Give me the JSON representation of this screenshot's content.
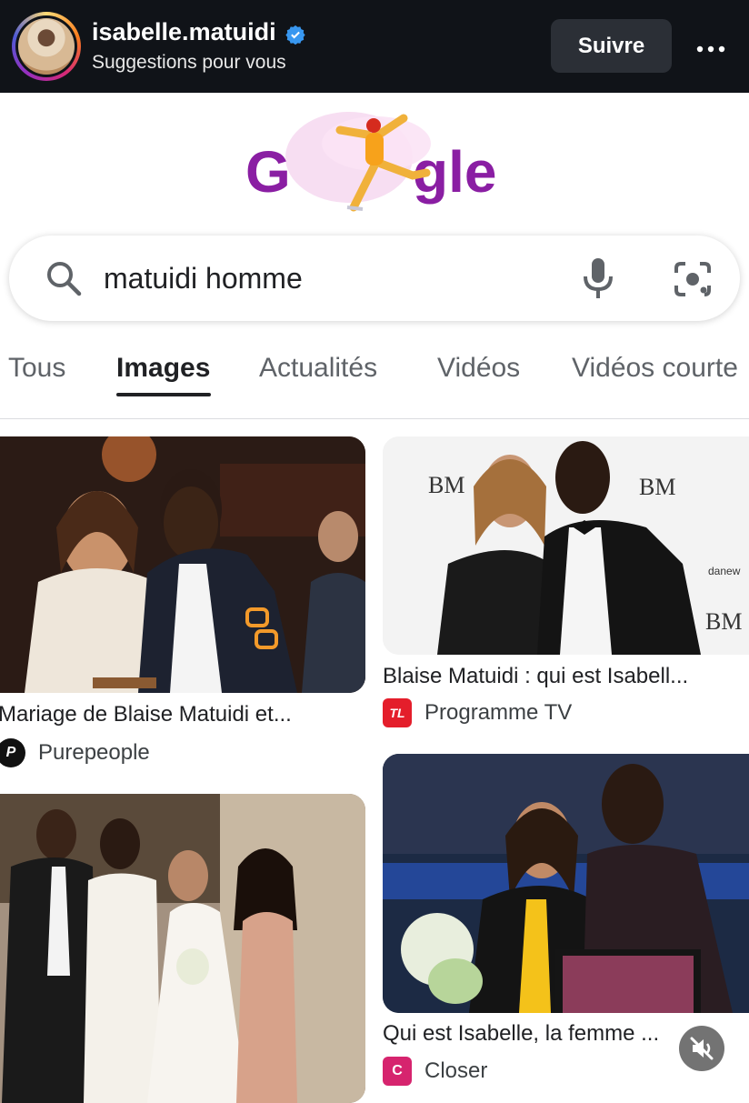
{
  "instagram": {
    "username": "isabelle.matuidi",
    "subtitle": "Suggestions pour vous",
    "follow_label": "Suivre"
  },
  "search": {
    "query": "matuidi homme"
  },
  "tabs": [
    {
      "label": "Tous"
    },
    {
      "label": "Images"
    },
    {
      "label": "Actualités"
    },
    {
      "label": "Vidéos"
    },
    {
      "label": "Vidéos courte"
    }
  ],
  "results": [
    {
      "title": "Mariage de Blaise Matuidi et...",
      "source": "Purepeople",
      "source_icon_text": "P"
    },
    {
      "title": "Blaise Matuidi : qui est Isabell...",
      "source": "Programme TV",
      "source_icon_text": "TL"
    },
    {
      "title": "",
      "source": "",
      "source_icon_text": ""
    },
    {
      "title": "Qui est Isabelle, la femme ...",
      "source": "Closer",
      "source_icon_text": "C"
    }
  ],
  "colors": {
    "header_bg": "#101318",
    "verified": "#3897f0",
    "programme_tv": "#e41e2b",
    "closer": "#d6246e"
  }
}
